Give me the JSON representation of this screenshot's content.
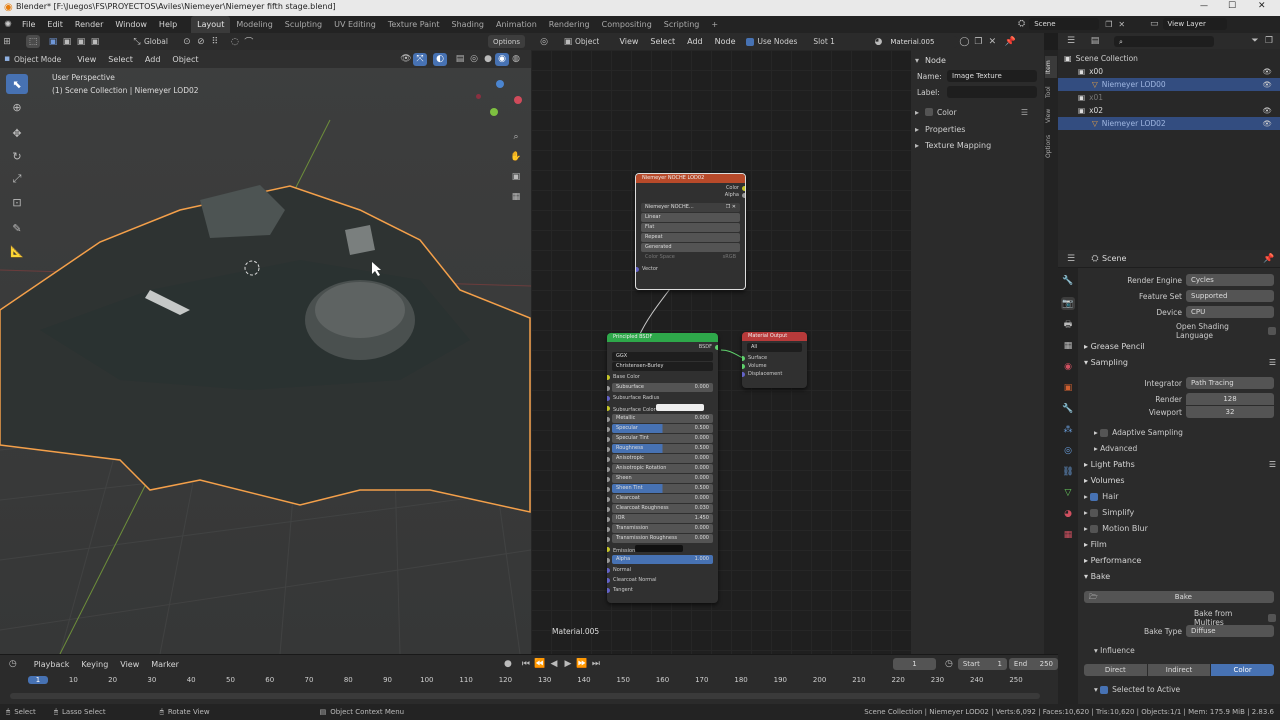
{
  "title": "Blender* [F:\\Juegos\\FS\\PROYECTOS\\Aviles\\Niemeyer\\Niemeyer fifth stage.blend]",
  "window_controls": {
    "min": "—",
    "max": "☐",
    "close": "✕"
  },
  "menu": {
    "file": "File",
    "edit": "Edit",
    "render": "Render",
    "window": "Window",
    "help": "Help"
  },
  "workspaces": [
    "Layout",
    "Modeling",
    "Sculpting",
    "UV Editing",
    "Texture Paint",
    "Shading",
    "Animation",
    "Rendering",
    "Compositing",
    "Scripting"
  ],
  "workspace_add": "+",
  "scene_name": "Scene",
  "view_layer": "View Layer",
  "viewport": {
    "transform": "Global",
    "options": "Options",
    "mode": "Object Mode",
    "view": "View",
    "select": "Select",
    "add": "Add",
    "object": "Object",
    "perspective": "User Perspective",
    "collection_info": "(1) Scene Collection | Niemeyer LOD02"
  },
  "node_editor": {
    "object": "Object",
    "view": "View",
    "select": "Select",
    "add": "Add",
    "node": "Node",
    "use_nodes": "Use Nodes",
    "slot": "Slot 1",
    "material": "Material.005",
    "footer_material": "Material.005",
    "tex_node": {
      "title": "Niemeyer NOCHE LOD02",
      "out_color": "Color",
      "out_alpha": "Alpha",
      "image": "Niemeyer NOCHE...",
      "interp": "Linear",
      "proj": "Flat",
      "ext": "Repeat",
      "source": "Generated",
      "cs_label": "Color Space",
      "cs_value": "sRGB",
      "vector": "Vector"
    },
    "bsdf_node": {
      "title": "Principled BSDF",
      "out": "BSDF",
      "dist": "GGX",
      "sss": "Christensen-Burley",
      "fields": [
        {
          "label": "Base Color",
          "value": ""
        },
        {
          "label": "Subsurface",
          "value": "0.000"
        },
        {
          "label": "Subsurface Radius",
          "value": ""
        },
        {
          "label": "Subsurface Color",
          "value": ""
        },
        {
          "label": "Metallic",
          "value": "0.000"
        },
        {
          "label": "Specular",
          "value": "0.500"
        },
        {
          "label": "Specular Tint",
          "value": "0.000"
        },
        {
          "label": "Roughness",
          "value": "0.500"
        },
        {
          "label": "Anisotropic",
          "value": "0.000"
        },
        {
          "label": "Anisotropic Rotation",
          "value": "0.000"
        },
        {
          "label": "Sheen",
          "value": "0.000"
        },
        {
          "label": "Sheen Tint",
          "value": "0.500"
        },
        {
          "label": "Clearcoat",
          "value": "0.000"
        },
        {
          "label": "Clearcoat Roughness",
          "value": "0.030"
        },
        {
          "label": "IOR",
          "value": "1.450"
        },
        {
          "label": "Transmission",
          "value": "0.000"
        },
        {
          "label": "Transmission Roughness",
          "value": "0.000"
        },
        {
          "label": "Emission",
          "value": ""
        },
        {
          "label": "Alpha",
          "value": "1.000"
        },
        {
          "label": "Normal",
          "value": ""
        },
        {
          "label": "Clearcoat Normal",
          "value": ""
        },
        {
          "label": "Tangent",
          "value": ""
        }
      ]
    },
    "out_node": {
      "title": "Material Output",
      "target": "All",
      "surface": "Surface",
      "volume": "Volume",
      "displacement": "Displacement"
    }
  },
  "npanel": {
    "node_header": "Node",
    "name_label": "Name:",
    "name_value": "Image Texture",
    "label_label": "Label:",
    "color_label": "Color",
    "properties": "Properties",
    "texture_mapping": "Texture Mapping",
    "tabs": [
      "Item",
      "Tool",
      "View",
      "Options"
    ]
  },
  "outliner": {
    "root": "Scene Collection",
    "items": [
      {
        "name": "x00",
        "depth": 1
      },
      {
        "name": "Niemeyer LOD00",
        "depth": 2
      },
      {
        "name": "x01",
        "depth": 1
      },
      {
        "name": "x02",
        "depth": 1
      },
      {
        "name": "Niemeyer LOD02",
        "depth": 2
      }
    ]
  },
  "properties": {
    "context": "Scene",
    "render_engine_label": "Render Engine",
    "render_engine": "Cycles",
    "feature_set_label": "Feature Set",
    "feature_set": "Supported",
    "device_label": "Device",
    "device": "CPU",
    "osl": "Open Shading Language",
    "grease_pencil": "Grease Pencil",
    "sampling": "Sampling",
    "integrator_label": "Integrator",
    "integrator": "Path Tracing",
    "render_label": "Render",
    "render_samples": "128",
    "viewport_label": "Viewport",
    "viewport_samples": "32",
    "adaptive": "Adaptive Sampling",
    "advanced": "Advanced",
    "light_paths": "Light Paths",
    "volumes": "Volumes",
    "hair": "Hair",
    "simplify": "Simplify",
    "motion_blur": "Motion Blur",
    "film": "Film",
    "performance": "Performance",
    "bake_section": "Bake",
    "bake_button": "Bake",
    "bake_multires": "Bake from Multires",
    "bake_type_label": "Bake Type",
    "bake_type": "Diffuse",
    "influence": "Influence",
    "direct": "Direct",
    "indirect": "Indirect",
    "color": "Color",
    "selected_to_active": "Selected to Active"
  },
  "timeline": {
    "playback": "Playback",
    "keying": "Keying",
    "view": "View",
    "marker": "Marker",
    "current_frame": "1",
    "start_label": "Start",
    "start": "1",
    "end_label": "End",
    "end": "250",
    "ticks": [
      "1",
      "10",
      "20",
      "30",
      "40",
      "50",
      "60",
      "70",
      "80",
      "90",
      "100",
      "110",
      "120",
      "130",
      "140",
      "150",
      "160",
      "170",
      "180",
      "190",
      "200",
      "210",
      "220",
      "230",
      "240",
      "250"
    ]
  },
  "status": {
    "select": "Select",
    "lasso": "Lasso Select",
    "rotate": "Rotate View",
    "context_menu": "Object Context Menu",
    "stats": "Scene Collection | Niemeyer LOD02 | Verts:6,092 | Faces:10,620 | Tris:10,620 | Objects:1/1 | Mem: 175.9 MiB | 2.83.6"
  },
  "colors": {
    "accent": "#4772b3",
    "selection_outline": "#f4a04a",
    "tex_header": "#b84a2a",
    "bsdf_header": "#2ea84a",
    "output_header": "#b83a3a"
  }
}
